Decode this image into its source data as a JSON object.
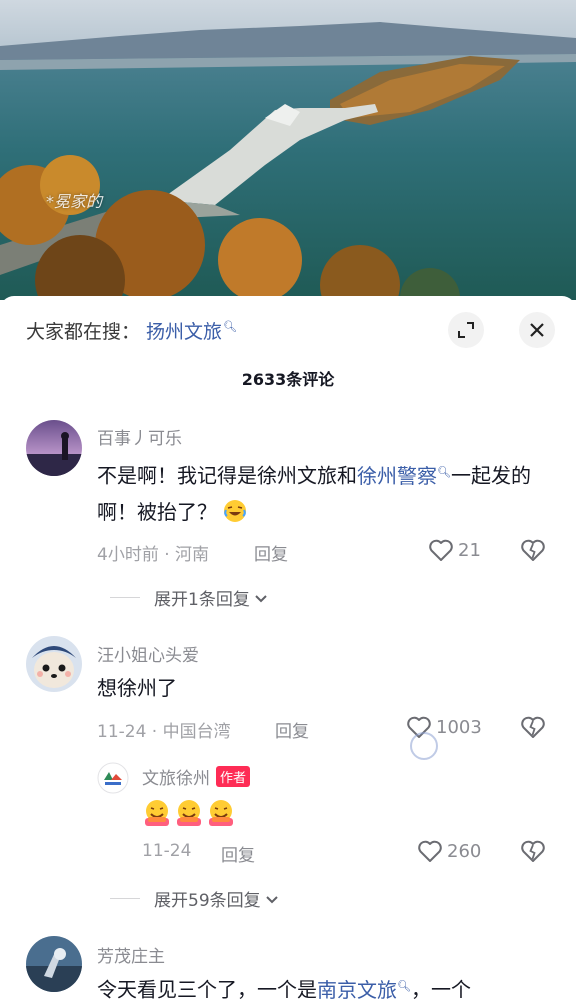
{
  "video": {
    "watermark": "*冕家的"
  },
  "header": {
    "search_prefix": "大家都在搜：",
    "search_keyword": "扬州文旅",
    "comment_count": "2633条评论"
  },
  "comments": [
    {
      "user": "百事丿可乐",
      "text_parts": [
        "不是啊！我记得是徐州文旅和",
        "徐州警察",
        "一起发的啊！被抬了？"
      ],
      "meta": "4小时前 · 河南",
      "reply_label": "回复",
      "likes": "21",
      "expand_label": "展开1条回复"
    },
    {
      "user": "汪小姐心头爱",
      "text": "想徐州了",
      "meta": "11-24 · 中国台湾",
      "reply_label": "回复",
      "likes": "1003",
      "reply": {
        "user": "文旅徐州",
        "badge": "作者",
        "meta": "11-24",
        "reply_label": "回复",
        "likes": "260"
      },
      "expand_label": "展开59条回复"
    },
    {
      "user": "芳茂庄主",
      "text_parts": [
        "令天看见三个了，一个是",
        "南京文旅",
        "，一个"
      ]
    }
  ],
  "icons": {
    "search_keyword_icon": "search-icon",
    "expand": "expand-icon",
    "close": "close-icon",
    "like": "heart-icon",
    "dislike": "broken-heart-icon",
    "chevron": "chevron-down-icon"
  },
  "colors": {
    "link": "#3b5ea8",
    "author_badge": "#fe2c55",
    "muted_text": "#8a8b91"
  }
}
